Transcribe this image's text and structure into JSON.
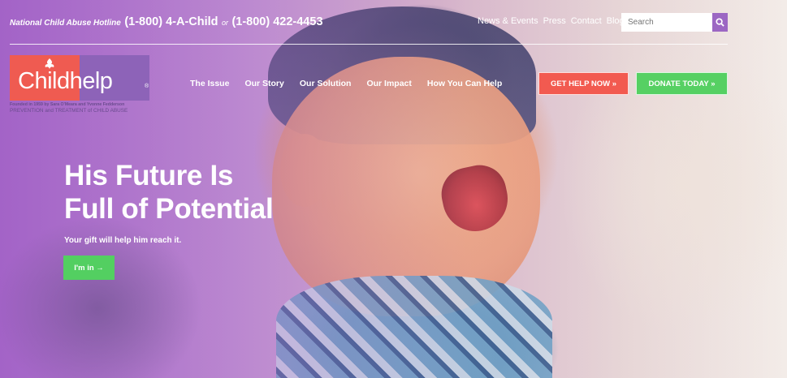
{
  "topbar": {
    "hotline_label": "National Child Abuse Hotline",
    "hotline_number_1": "(1-800) 4-A-Child",
    "hotline_or": "or",
    "hotline_number_2": "(1-800) 422-4453",
    "links": [
      "News & Events",
      "Press",
      "Contact",
      "Blog"
    ],
    "search_placeholder": "Search",
    "search_icon": "search-icon"
  },
  "logo": {
    "wordmark": "Childhelp",
    "registered": "®",
    "founded": "Founded in 1959 by Sara O'Meara and Yvonne Fedderson",
    "tagline": "PREVENTION and TREATMENT of CHILD ABUSE"
  },
  "nav": {
    "items": [
      "The Issue",
      "Our Story",
      "Our Solution",
      "Our Impact",
      "How You Can Help"
    ]
  },
  "buttons": {
    "get_help": "GET HELP NOW »",
    "donate": "DONATE TODAY »"
  },
  "hero": {
    "headline_line1": "His Future Is",
    "headline_line2": "Full of Potential",
    "subtext": "Your gift will help him reach it.",
    "cta": "I'm in →"
  },
  "colors": {
    "red": "#f25a50",
    "green": "#56d063",
    "purple": "#9c67c3"
  }
}
